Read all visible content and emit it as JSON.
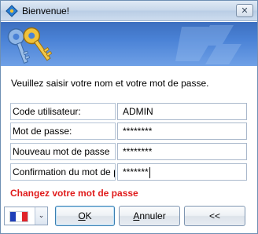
{
  "window": {
    "title": "Bienvenue!",
    "close_glyph": "✕",
    "app_icon": "blue-diamond-icon"
  },
  "banner": {
    "left_graphic": "keys-icon",
    "right_graphic": "key-watermark-icon"
  },
  "form": {
    "prompt": "Veuillez saisir votre nom et votre mot de passe.",
    "fields": [
      {
        "label": "Code utilisateur:",
        "value": "ADMIN"
      },
      {
        "label": "Mot de passe:",
        "value": "********"
      },
      {
        "label": "Nouveau mot de passe",
        "value": "********"
      },
      {
        "label": "Confirmation du mot de p",
        "value": "*******"
      }
    ],
    "warning": "Changez votre mot de passe"
  },
  "language": {
    "flag": "france-flag-icon",
    "dropdown_glyph": "⌄"
  },
  "buttons": {
    "ok_mnemonic": "O",
    "ok_rest": "K",
    "cancel_mnemonic": "A",
    "cancel_rest": "nnuler",
    "back_label": "<<"
  },
  "colors": {
    "warning": "#e01b1b",
    "banner": "#4a82d6",
    "flag_blue": "#1f3fb8",
    "flag_white": "#ffffff",
    "flag_red": "#e0242a"
  }
}
